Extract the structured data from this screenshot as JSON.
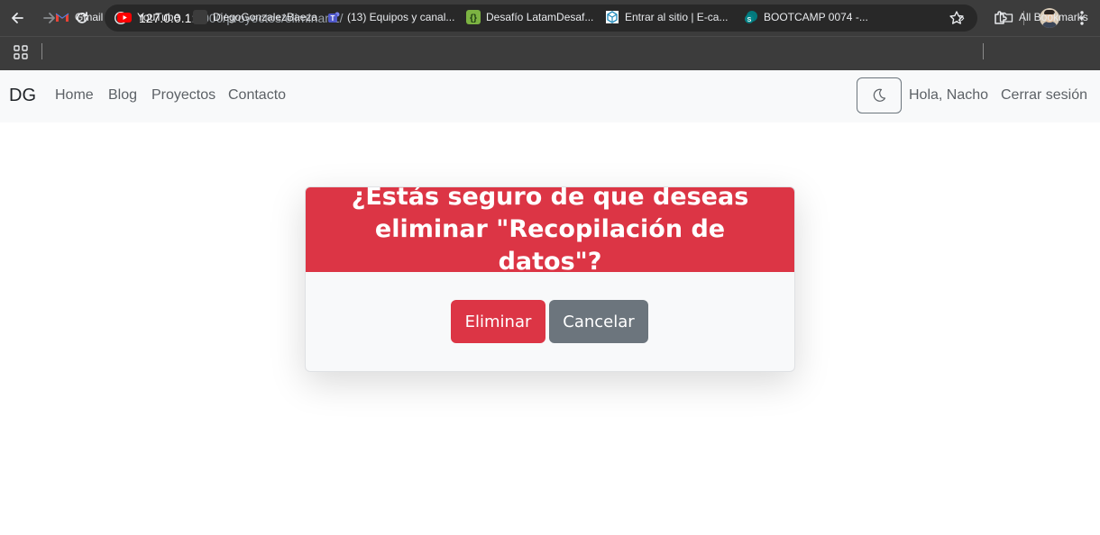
{
  "browser": {
    "url_host": "127.0.0.1",
    "url_path": ":8000/proyectos/eliminar/1/",
    "bookmarks": [
      {
        "label": "Gmail",
        "icon": "gmail-icon",
        "color": "#ea4335"
      },
      {
        "label": "YouTube",
        "icon": "youtube-icon",
        "color": "#ff0000"
      },
      {
        "label": "DiegoGonzalezBaeza",
        "icon": "blank-icon",
        "color": "#3c3c3c"
      },
      {
        "label": "(13) Equipos y canal...",
        "icon": "teams-icon",
        "color": "#6264a7"
      },
      {
        "label": "Desafío LatamDesaf...",
        "icon": "desafio-icon",
        "color": "#7cb342"
      },
      {
        "label": "Entrar al sitio | E-ca...",
        "icon": "moodle-icon",
        "color": "#2a8fbd"
      },
      {
        "label": "BOOTCAMP 0074 -...",
        "icon": "sharepoint-icon",
        "color": "#038387"
      }
    ],
    "overflow_label": "»",
    "all_bookmarks_label": "All Bookmarks"
  },
  "navbar": {
    "brand": "DG",
    "links": [
      "Home",
      "Blog",
      "Proyectos",
      "Contacto"
    ],
    "greeting": "Hola, Nacho",
    "logout": "Cerrar sesión"
  },
  "card": {
    "title": "¿Estás seguro de que deseas eliminar \"Recopilación de datos\"?",
    "delete_label": "Eliminar",
    "cancel_label": "Cancelar"
  },
  "colors": {
    "danger": "#dc3545",
    "secondary": "#6c757d",
    "navbar_bg": "#f8f9fa",
    "chrome_bg": "#3c3c3c"
  }
}
